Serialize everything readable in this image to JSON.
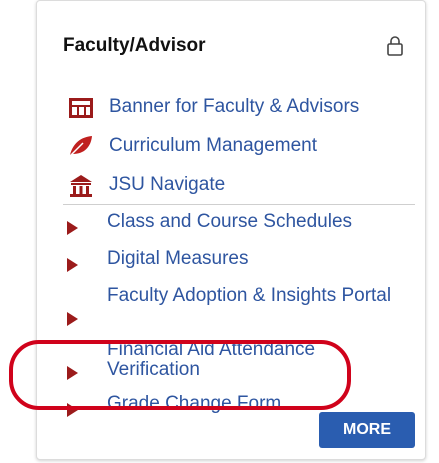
{
  "widget": {
    "title": "Faculty/Advisor",
    "lock_icon": "lock-icon"
  },
  "quick_links": [
    {
      "label": "Banner for Faculty & Advisors",
      "icon": "banner-icon"
    },
    {
      "label": "Curriculum Management",
      "icon": "leaf-icon"
    },
    {
      "label": "JSU Navigate",
      "icon": "building-icon"
    }
  ],
  "list_links": [
    {
      "label": "Class and Course Schedules"
    },
    {
      "label": "Digital Measures"
    },
    {
      "label": "Faculty Adoption & Insights Portal"
    },
    {
      "label": "Financial Aid Attendance Verification"
    },
    {
      "label": "Grade Change Form"
    }
  ],
  "more_button": {
    "label": "MORE"
  },
  "colors": {
    "link": "#2e55a0",
    "bullet": "#9b1b1b",
    "button": "#2a5db0",
    "highlight": "#d0021b"
  }
}
